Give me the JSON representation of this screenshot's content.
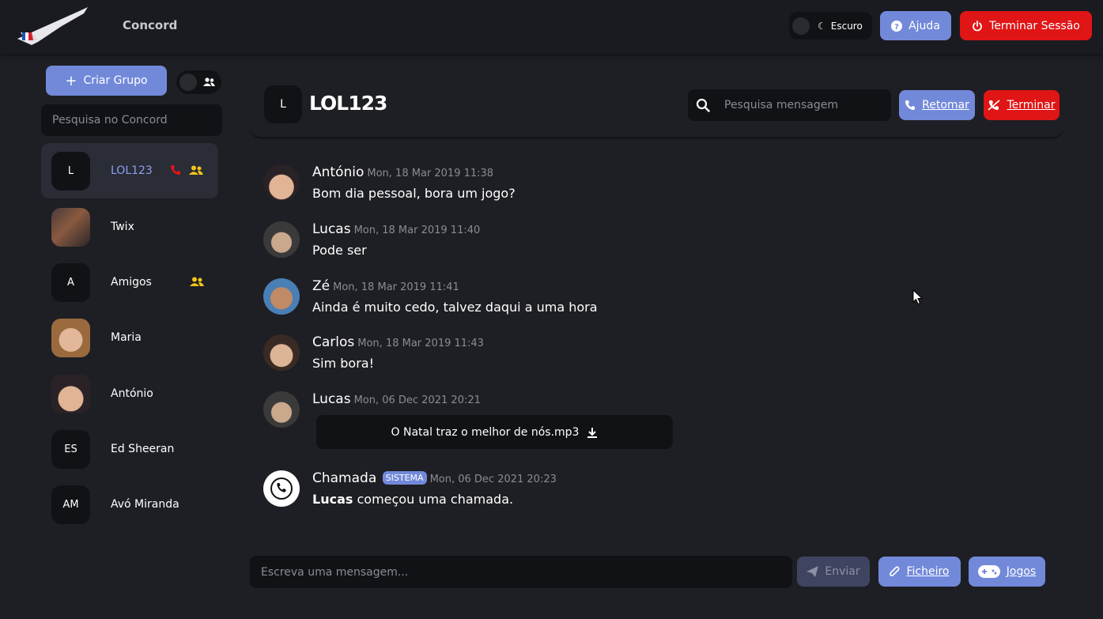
{
  "topbar": {
    "app_title": "Concord",
    "theme_label": "Escuro",
    "help_label": "Ajuda",
    "logout_label": "Terminar Sessão"
  },
  "sidebar": {
    "create_group_label": "Criar Grupo",
    "search_placeholder": "Pesquisa no Concord",
    "contacts": [
      {
        "name": "LOL123",
        "initials": "L",
        "active": true,
        "in_call": true,
        "is_group": true
      },
      {
        "name": "Twix",
        "initials": "",
        "photo": true
      },
      {
        "name": "Amigos",
        "initials": "A",
        "is_group": true
      },
      {
        "name": "Maria",
        "initials": "",
        "photo": true
      },
      {
        "name": "António",
        "initials": "",
        "photo": true
      },
      {
        "name": "Ed Sheeran",
        "initials": "ES"
      },
      {
        "name": "Avó Miranda",
        "initials": "AM"
      }
    ]
  },
  "chat": {
    "avatar_initial": "L",
    "title": "LOL123",
    "search_placeholder": "Pesquisa mensagem",
    "resume_label": "Retomar",
    "end_label": "Terminar",
    "messages": [
      {
        "author": "António",
        "time": "Mon, 18 Mar 2019 11:38",
        "text": "Bom dia pessoal, bora um jogo?"
      },
      {
        "author": "Lucas",
        "time": "Mon, 18 Mar 2019 11:40",
        "text": "Pode ser"
      },
      {
        "author": "Zé",
        "time": "Mon, 18 Mar 2019 11:41",
        "text": "Ainda é muito cedo, talvez daqui a uma hora"
      },
      {
        "author": "Carlos",
        "time": "Mon, 18 Mar 2019 11:43",
        "text": "Sim bora!"
      },
      {
        "author": "Lucas",
        "time": "Mon, 06 Dec 2021 20:21",
        "file": "O Natal traz o melhor de nós.mp3"
      },
      {
        "author": "Chamada",
        "badge": "SISTEMA",
        "time": "Mon, 06 Dec 2021 20:23",
        "bold": "Lucas",
        "text": " começou uma chamada."
      }
    ]
  },
  "composer": {
    "placeholder": "Escreva uma mensagem...",
    "send_label": "Enviar",
    "file_label": "Ficheiro",
    "games_label": "Jogos"
  },
  "colors": {
    "accent": "#7289da",
    "danger": "#e01515",
    "background": "#1e1f24",
    "group_icon": "#f5c518"
  }
}
